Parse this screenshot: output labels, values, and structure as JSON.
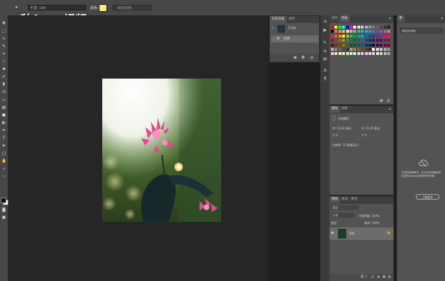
{
  "optionbar": {
    "brush_label": "",
    "mode_field": "不透: 100",
    "color_label": "颜色:",
    "color_value": "#f3ef6a",
    "secondary_field": "填充全部"
  },
  "watermark": {
    "part1": "秒",
    "part2": "d",
    "part3": "ng",
    "part4": "视频",
    "accent": "o"
  },
  "history": {
    "tabs": [
      "历史记录",
      "动作"
    ],
    "snapshot_label": "1.jpg",
    "state_label": "打开"
  },
  "swatches": {
    "tabs": [
      "颜色",
      "色板"
    ],
    "rows": [
      [
        "#ff0000",
        "#ffff00",
        "#00ff00",
        "#00ffff",
        "#0000ff",
        "#ff00ff",
        "#ffffff",
        "#e6e6e6",
        "#cccccc",
        "#b3b3b3",
        "#999999",
        "#808080",
        "#666666",
        "#4d4d4d",
        "#333333",
        "#1a1a1a"
      ],
      [
        "#000000",
        "#f26c4f",
        "#f68e55",
        "#fbaf5c",
        "#fff467",
        "#acd372",
        "#7cc576",
        "#3bb878",
        "#1abbb4",
        "#00bff3",
        "#438ccb",
        "#5574b9",
        "#605ca8",
        "#855fa8",
        "#a763a8",
        "#f06ea9"
      ],
      [
        "#ed1c24",
        "#f26522",
        "#f7941d",
        "#fff200",
        "#8dc63f",
        "#39b54a",
        "#00a651",
        "#00a99d",
        "#00aeef",
        "#0072bc",
        "#0054a6",
        "#2e3192",
        "#662d91",
        "#92278f",
        "#ec008c",
        "#ed145b"
      ],
      [
        "#9e0b0f",
        "#a0410d",
        "#a36209",
        "#aba000",
        "#598527",
        "#1a7b30",
        "#007236",
        "#00746b",
        "#0076a3",
        "#004b80",
        "#003471",
        "#1b1464",
        "#440e62",
        "#630460",
        "#9e005d",
        "#9e0039"
      ],
      [
        "#790000",
        "#7b2e00",
        "#7d4900",
        "#827b00",
        "#406618",
        "#005e20",
        "#005826",
        "#005952",
        "#005b7f",
        "#003663",
        "#002157",
        "#0d004c",
        "#32004b",
        "#4b0049",
        "#7b0046",
        "#7a0026"
      ],
      [
        "#c7b299",
        "#998675",
        "#736357",
        "#534741",
        "#37302d",
        "#c69c6d",
        "#a67c52",
        "#8c6239",
        "#754c24",
        "#603913",
        "#3c2415",
        "#ffffff",
        "#e6e6e6",
        "#cccccc",
        "#b3b3b3",
        "#999999"
      ],
      [
        "#ffcccc",
        "#ffe5cc",
        "#ffffcc",
        "#e5ffcc",
        "#ccffcc",
        "#ccffe5",
        "#ccffff",
        "#cce5ff",
        "#ccccff",
        "#e5ccff",
        "#ffccff",
        "#ffcce5",
        "#f2f2f2",
        "#d9d9d9",
        "#bfbfbf",
        "#a6a6a6"
      ]
    ]
  },
  "properties": {
    "tabs": [
      "属性",
      "调整"
    ],
    "title": "文档属性",
    "w_label": "W: 16.94 厘米",
    "h_label": "H: 21.45 厘米",
    "x_label": "X: 0",
    "y_label": "Y: 0",
    "res_label": "分辨率: 72 像素/英寸"
  },
  "layers": {
    "tabs": [
      "图层",
      "通道",
      "路径"
    ],
    "kind_label": "类型",
    "mode_label": "正常",
    "opacity_label": "不透明度: 100%",
    "lock_label": "锁定:",
    "fill_label": "填充: 100%",
    "layer_name": "背景"
  },
  "libraries": {
    "header": "库",
    "select_value": "我的资源库",
    "message": "在您的资源库中，可以访问和使用来自其他Adobe应用程序的资源。",
    "learn_button": "了解更多"
  }
}
